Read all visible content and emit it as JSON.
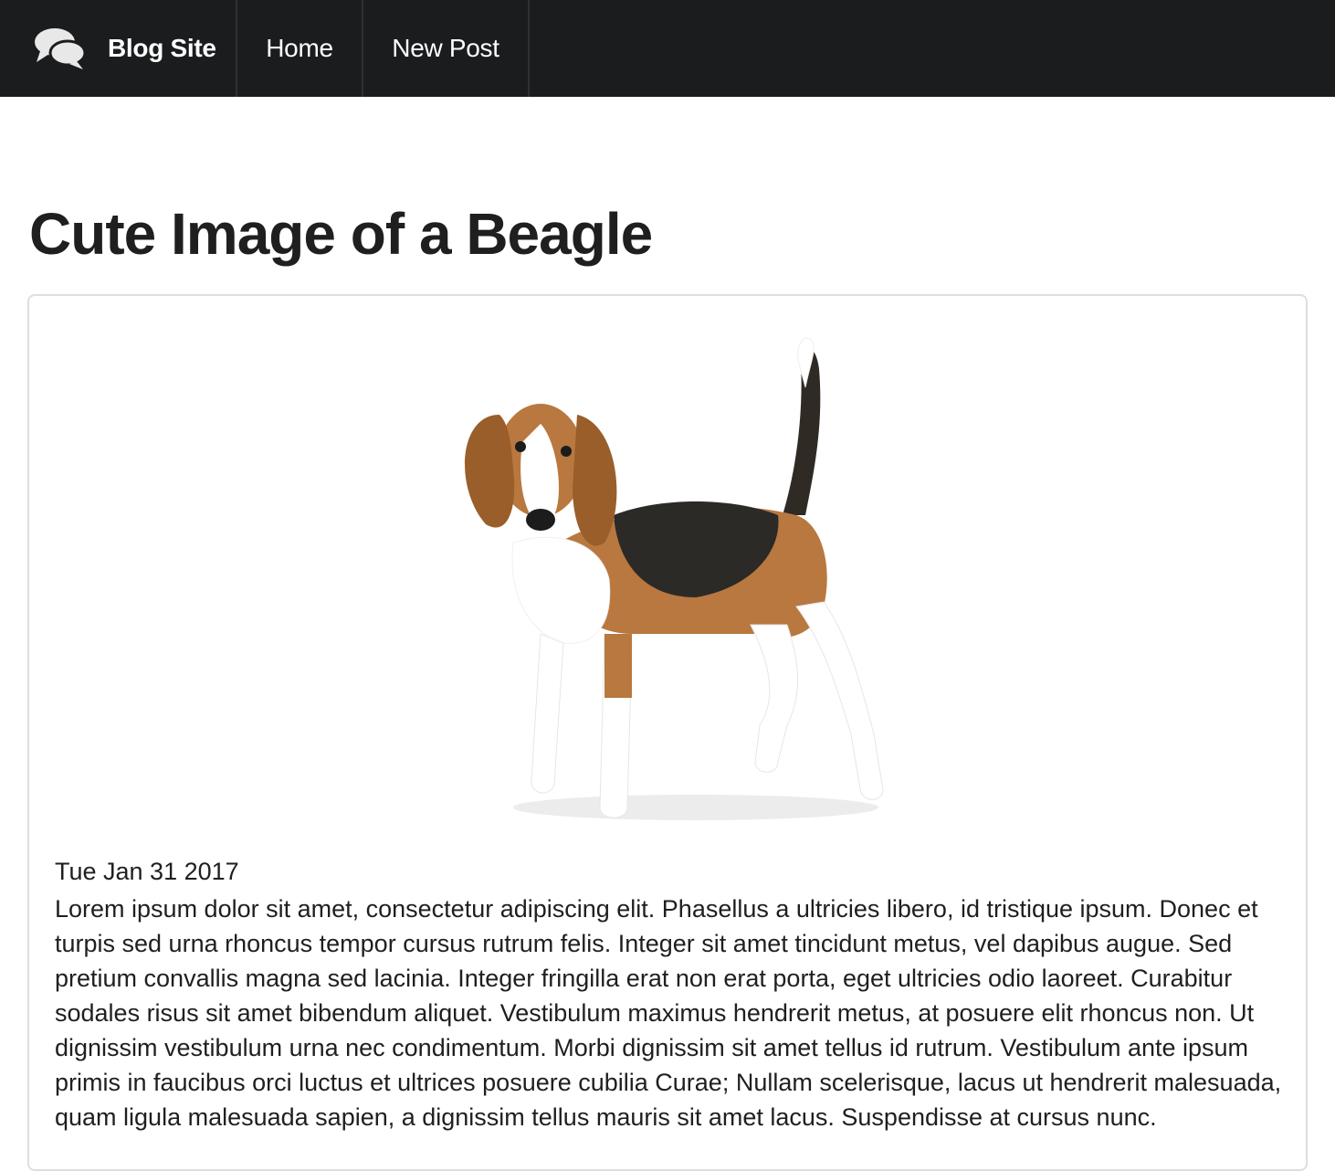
{
  "nav": {
    "brand_label": "Blog Site",
    "brand_icon": "comments-icon",
    "home_label": "Home",
    "new_post_label": "New Post"
  },
  "post": {
    "title": "Cute Image of a Beagle",
    "image_subject": "beagle-dog-photo",
    "date": "Tue Jan 31 2017",
    "body": "Lorem ipsum dolor sit amet, consectetur adipiscing elit. Phasellus a ultricies libero, id tristique ipsum. Donec et turpis sed urna rhoncus tempor cursus rutrum felis. Integer sit amet tincidunt metus, vel dapibus augue. Sed pretium convallis magna sed lacinia. Integer fringilla erat non erat porta, eget ultricies odio laoreet. Curabitur sodales risus sit amet bibendum aliquet. Vestibulum maximus hendrerit metus, at posuere elit rhoncus non. Ut dignissim vestibulum urna nec condimentum. Morbi dignissim sit amet tellus id rutrum. Vestibulum ante ipsum primis in faucibus orci luctus et ultrices posuere cubilia Curae; Nullam scelerisque, lacus ut hendrerit malesuada, quam ligula malesuada sapien, a dignissim tellus mauris sit amet lacus. Suspendisse at cursus nunc."
  },
  "colors": {
    "navbar_bg": "#1b1c1d",
    "text": "#1f1f1f",
    "card_border": "#dededf"
  }
}
